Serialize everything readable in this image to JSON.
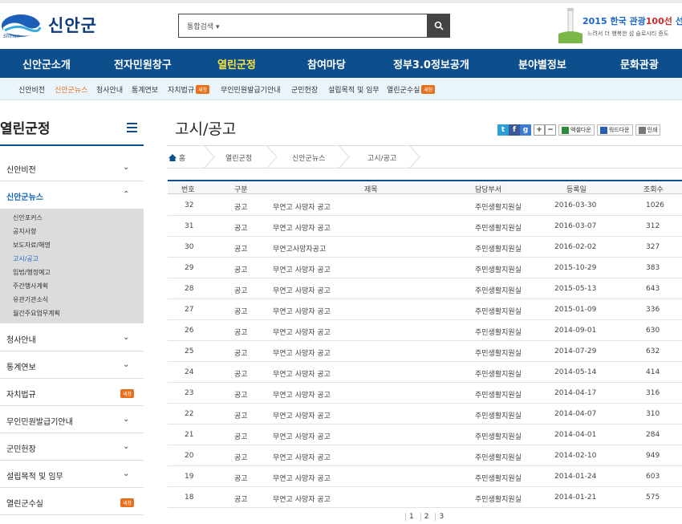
{
  "header": {
    "logo_text": "신안군",
    "logo_sub": "Shinan",
    "search_select": "통합검색",
    "banner_title_a": "2015 한국 관광",
    "banner_title_b": "100선",
    "banner_title_c": "선정",
    "banner_sub": "느려서 더 행복한 섬 슬로시티 증도"
  },
  "gnb": [
    "신안군소개",
    "전자민원창구",
    "열린군정",
    "참여마당",
    "정부3.0정보공개",
    "분야별정보",
    "문화관광"
  ],
  "lnb": [
    "신안비전",
    "신안군뉴스",
    "청사안내",
    "통계연보",
    "자치법규",
    "무인민원발급기안내",
    "군민헌장",
    "설립목적 및 임무",
    "열린군수실"
  ],
  "badge_new": "새창",
  "sidebar": {
    "title": "열린군정",
    "items": [
      "신안비전",
      "신안군뉴스",
      "청사안내",
      "통계연보",
      "자치법규",
      "무인민원발급기안내",
      "군민헌장",
      "설립목적 및 임무",
      "열린군수실"
    ],
    "sub_items": [
      "신안포커스",
      "공지사항",
      "보도자료/해명",
      "고시/공고",
      "입법/행정예고",
      "주간행사계획",
      "유관기관소식",
      "월간주요업무계획"
    ]
  },
  "main": {
    "title": "고시/공고",
    "toolbar": {
      "excel": "엑셀다운",
      "word": "워드다운",
      "print": "인쇄"
    },
    "breadcrumb": [
      "홈",
      "열린군정",
      "신안군뉴스",
      "고시/공고"
    ]
  },
  "table": {
    "headers": [
      "번호",
      "구분",
      "제목",
      "담당부서",
      "등록일",
      "조회수"
    ],
    "rows": [
      [
        "32",
        "공고",
        "무연고 사망자 공고",
        "주민생활지원실",
        "2016-03-30",
        "1026"
      ],
      [
        "31",
        "공고",
        "무연고 사망자 공고",
        "주민생활지원실",
        "2016-03-07",
        "312"
      ],
      [
        "30",
        "공고",
        "무연고사망자공고",
        "주민생활지원실",
        "2016-02-02",
        "327"
      ],
      [
        "29",
        "공고",
        "무연고 사망자 공고",
        "주민생활지원실",
        "2015-10-29",
        "383"
      ],
      [
        "28",
        "공고",
        "무연고 사망자 공고",
        "주민생활지원실",
        "2015-05-13",
        "643"
      ],
      [
        "27",
        "공고",
        "무연고 사망자 공고",
        "주민생활지원실",
        "2015-01-09",
        "336"
      ],
      [
        "26",
        "공고",
        "무연고 사망자 공고",
        "주민생활지원실",
        "2014-09-01",
        "630"
      ],
      [
        "25",
        "공고",
        "무연고 사망자 공고",
        "주민생활지원실",
        "2014-07-29",
        "632"
      ],
      [
        "24",
        "공고",
        "무연고 사망자 공고",
        "주민생활지원실",
        "2014-05-14",
        "414"
      ],
      [
        "23",
        "공고",
        "무연고 사망자 공고",
        "주민생활지원실",
        "2014-04-17",
        "316"
      ],
      [
        "22",
        "공고",
        "무연고 사망자 공고",
        "주민생활지원실",
        "2014-04-07",
        "310"
      ],
      [
        "21",
        "공고",
        "무연고 사망자 공고",
        "주민생활지원실",
        "2014-04-01",
        "284"
      ],
      [
        "20",
        "공고",
        "무연고 사망자 공고",
        "주민생활지원실",
        "2014-02-10",
        "949"
      ],
      [
        "19",
        "공고",
        "무연고 사망자 공고",
        "주민생활지원실",
        "2014-01-24",
        "603"
      ],
      [
        "18",
        "공고",
        "무연고 사망자 공고",
        "주민생활지원실",
        "2014-01-21",
        "575"
      ]
    ]
  },
  "pager": [
    "1",
    "2",
    "3"
  ],
  "colors": {
    "primary": "#0d4f8d",
    "accent": "#ffe43b",
    "badge": "#e8701a"
  }
}
